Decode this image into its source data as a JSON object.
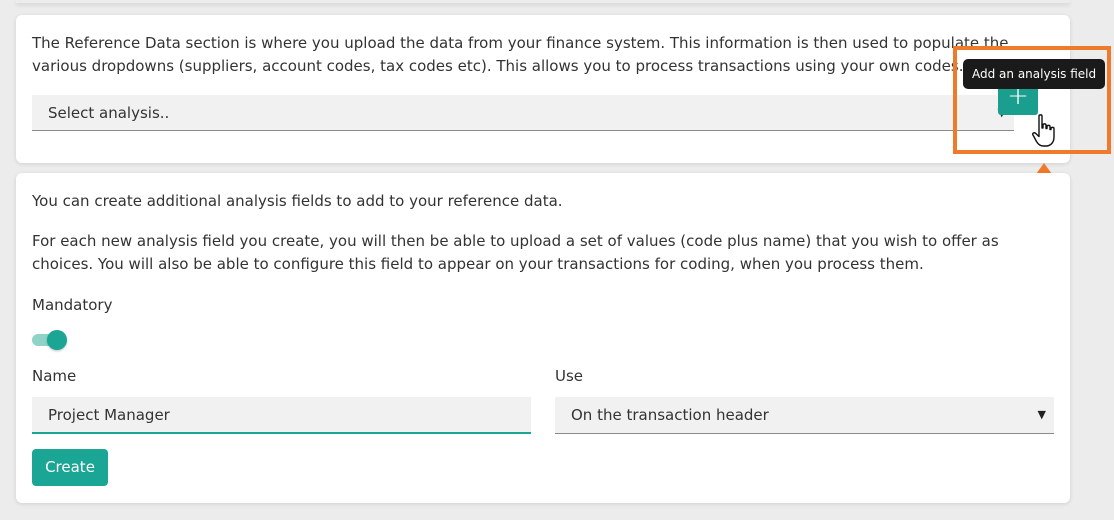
{
  "reference": {
    "description": "The Reference Data section is where you upload the data from your finance system. This information is then used to populate the various dropdowns (suppliers, account codes, tax codes etc). This allows you to process transactions using your own codes.",
    "select_value": "Select analysis..",
    "add_button_icon": "+",
    "tooltip": "Add an analysis field"
  },
  "analysis_form": {
    "intro": "You can create additional analysis fields to add to your reference data.",
    "details": "For each new analysis field you create, you will then be able to upload a set of values (code plus name) that you wish to offer as choices. You will also be able to configure this field to appear on your transactions for coding, when you process them.",
    "mandatory_label": "Mandatory",
    "mandatory_on": true,
    "name_label": "Name",
    "name_value": "Project Manager",
    "use_label": "Use",
    "use_value": "On the transaction header",
    "create_label": "Create"
  },
  "colors": {
    "accent": "#1aa595",
    "highlight": "#f07a2b"
  },
  "icons": {
    "dropdown": "caret-down-icon",
    "add": "plus-icon",
    "cursor": "hand-pointer-icon",
    "annotation": "arrow-up-icon"
  }
}
